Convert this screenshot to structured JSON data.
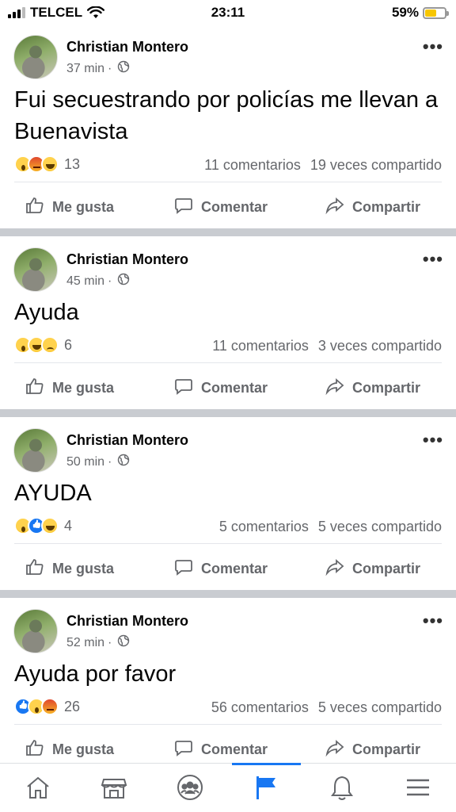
{
  "status_bar": {
    "carrier": "TELCEL",
    "time": "23:11",
    "battery_percent": "59%",
    "battery_level": 0.59,
    "wifi_icon": "wifi-icon"
  },
  "labels": {
    "like": "Me gusta",
    "comment": "Comentar",
    "share": "Compartir"
  },
  "posts": [
    {
      "author": "Christian Montero",
      "time": "37 min",
      "separator": "·",
      "text": "Fui secuestrando por policías me llevan a Buenavista",
      "reactions": [
        "wow",
        "angry",
        "haha"
      ],
      "reaction_count": "13",
      "comments": "11 comentarios",
      "shares": "19 veces compartido"
    },
    {
      "author": "Christian Montero",
      "time": "45 min",
      "separator": "·",
      "text": "Ayuda",
      "reactions": [
        "wow",
        "haha",
        "sad"
      ],
      "reaction_count": "6",
      "comments": "11 comentarios",
      "shares": "3 veces compartido"
    },
    {
      "author": "Christian Montero",
      "time": "50 min",
      "separator": "·",
      "text": "AYUDA",
      "reactions": [
        "wow",
        "like",
        "haha"
      ],
      "reaction_count": "4",
      "comments": "5 comentarios",
      "shares": "5 veces compartido"
    },
    {
      "author": "Christian Montero",
      "time": "52 min",
      "separator": "·",
      "text": "Ayuda por favor",
      "reactions": [
        "like",
        "wow",
        "angry"
      ],
      "reaction_count": "26",
      "comments": "56 comentarios",
      "shares": "5 veces compartido"
    }
  ],
  "tabbar": {
    "tabs": [
      "home-icon",
      "marketplace-icon",
      "groups-icon",
      "pages-flag-icon",
      "notifications-bell-icon",
      "menu-icon"
    ],
    "active": "pages-flag-icon"
  },
  "colors": {
    "accent": "#1877f2",
    "muted_text": "#65676b",
    "separator": "#c9ccd1"
  }
}
